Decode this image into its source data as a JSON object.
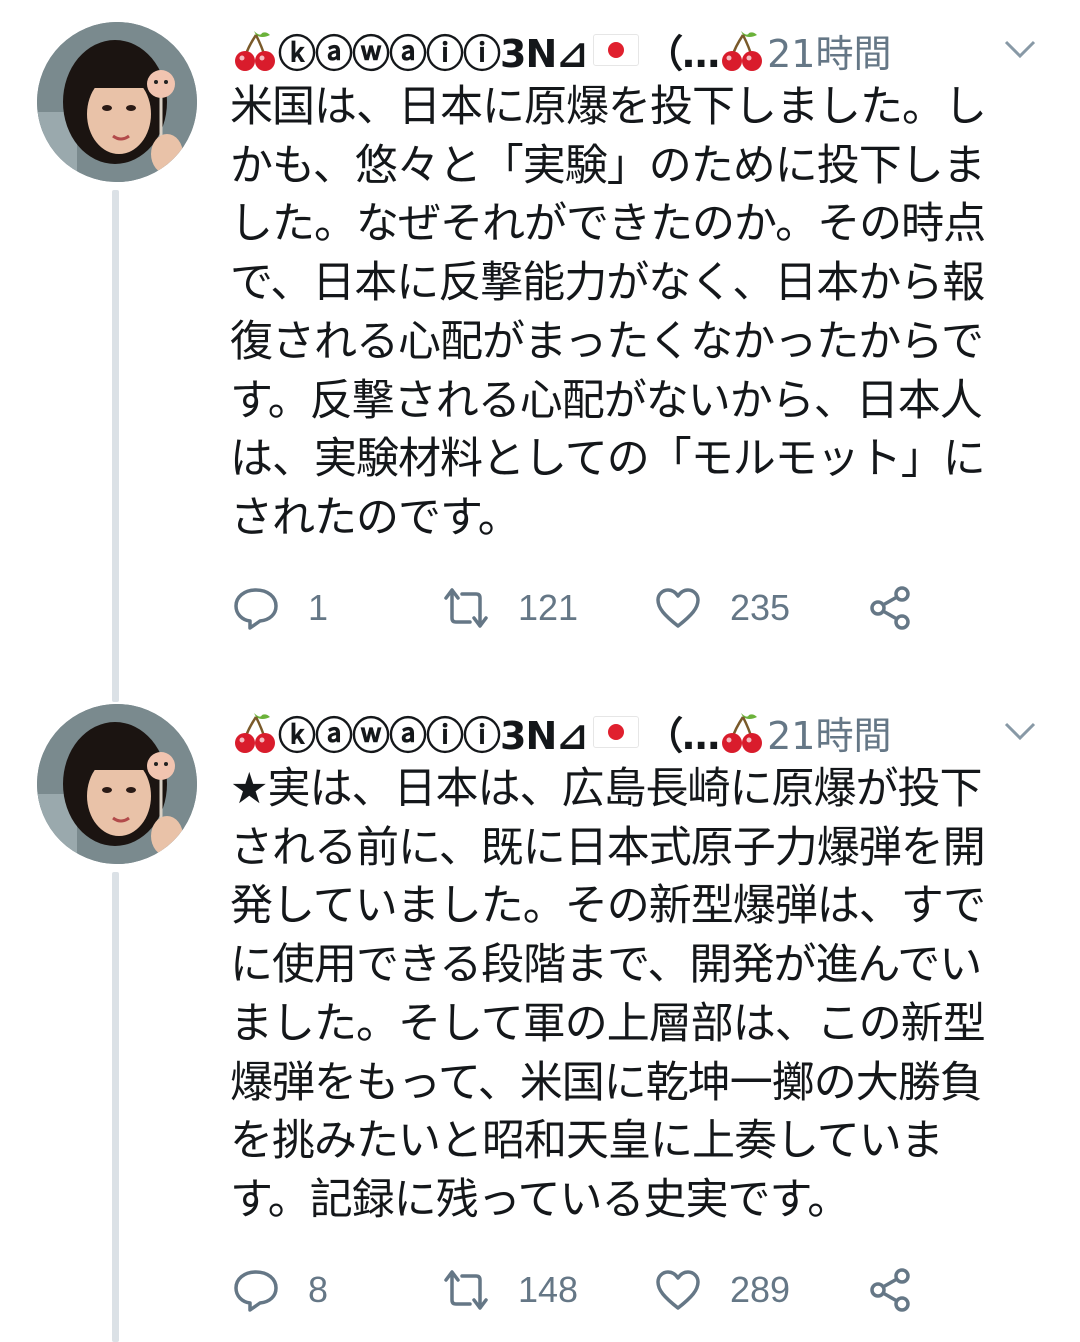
{
  "tweets": [
    {
      "display_name": "ⓚⓐⓦⓐⓘⓘ3N⊿",
      "name_suffix": "（…",
      "time": "21時間",
      "lines": [
        "米国は、日本に原爆を投下しました。し",
        "かも、悠々と「実験」のために投下しま",
        "した。なぜそれができたのか。その時点",
        "で、日本に反撃能力がなく、日本から報",
        "復される心配がまったくなかったからで",
        "す。反撃される心配がないから、日本人",
        "は、実験材料としての「モルモット」に",
        "されたのです。"
      ],
      "replies": "1",
      "retweets": "121",
      "likes": "235"
    },
    {
      "display_name": "ⓚⓐⓦⓐⓘⓘ3N⊿",
      "name_suffix": "（…",
      "time": "21時間",
      "lines": [
        "★実は、日本は、広島長崎に原爆が投下",
        "される前に、既に日本式原子力爆弾を開",
        "発していました。その新型爆弾は、すで",
        "に使用できる段階まで、開発が進んでい",
        "ました。そして軍の上層部は、この新型",
        "爆弾をもって、米国に乾坤一擲の大勝負",
        "を挑みたいと昭和天皇に上奏していま",
        "す。記録に残っている史実です。"
      ],
      "replies": "8",
      "retweets": "148",
      "likes": "289"
    }
  ],
  "colors": {
    "text": "#14171a",
    "muted": "#657786",
    "thread_line": "#dbe1e6"
  },
  "icons": [
    "cherry-icon",
    "japan-flag-icon",
    "chevron-down-icon",
    "reply-icon",
    "retweet-icon",
    "like-icon",
    "share-icon"
  ]
}
